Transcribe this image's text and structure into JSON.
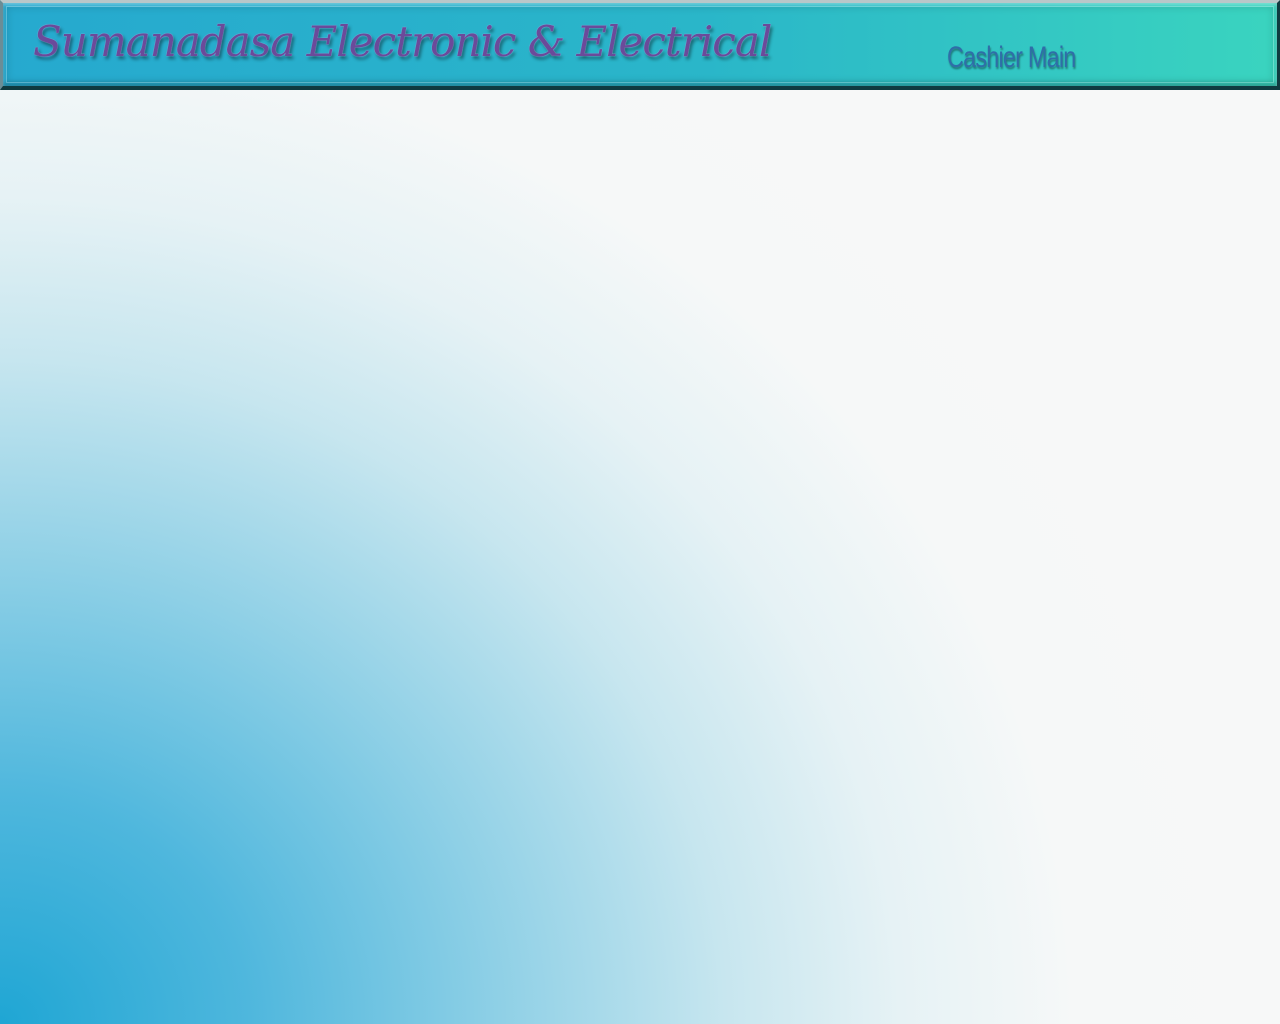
{
  "header": {
    "brand_title": "Sumanadasa Electronic & Electrical",
    "page_label": "Cashier Main"
  },
  "colors": {
    "header_start": "#26a9cf",
    "header_end": "#3ad4bf",
    "brand_text": "#6b4a9a",
    "page_label_text": "#2f6ea8",
    "background_accent": "#1fa6d4",
    "background_light": "#f7f8f8"
  }
}
